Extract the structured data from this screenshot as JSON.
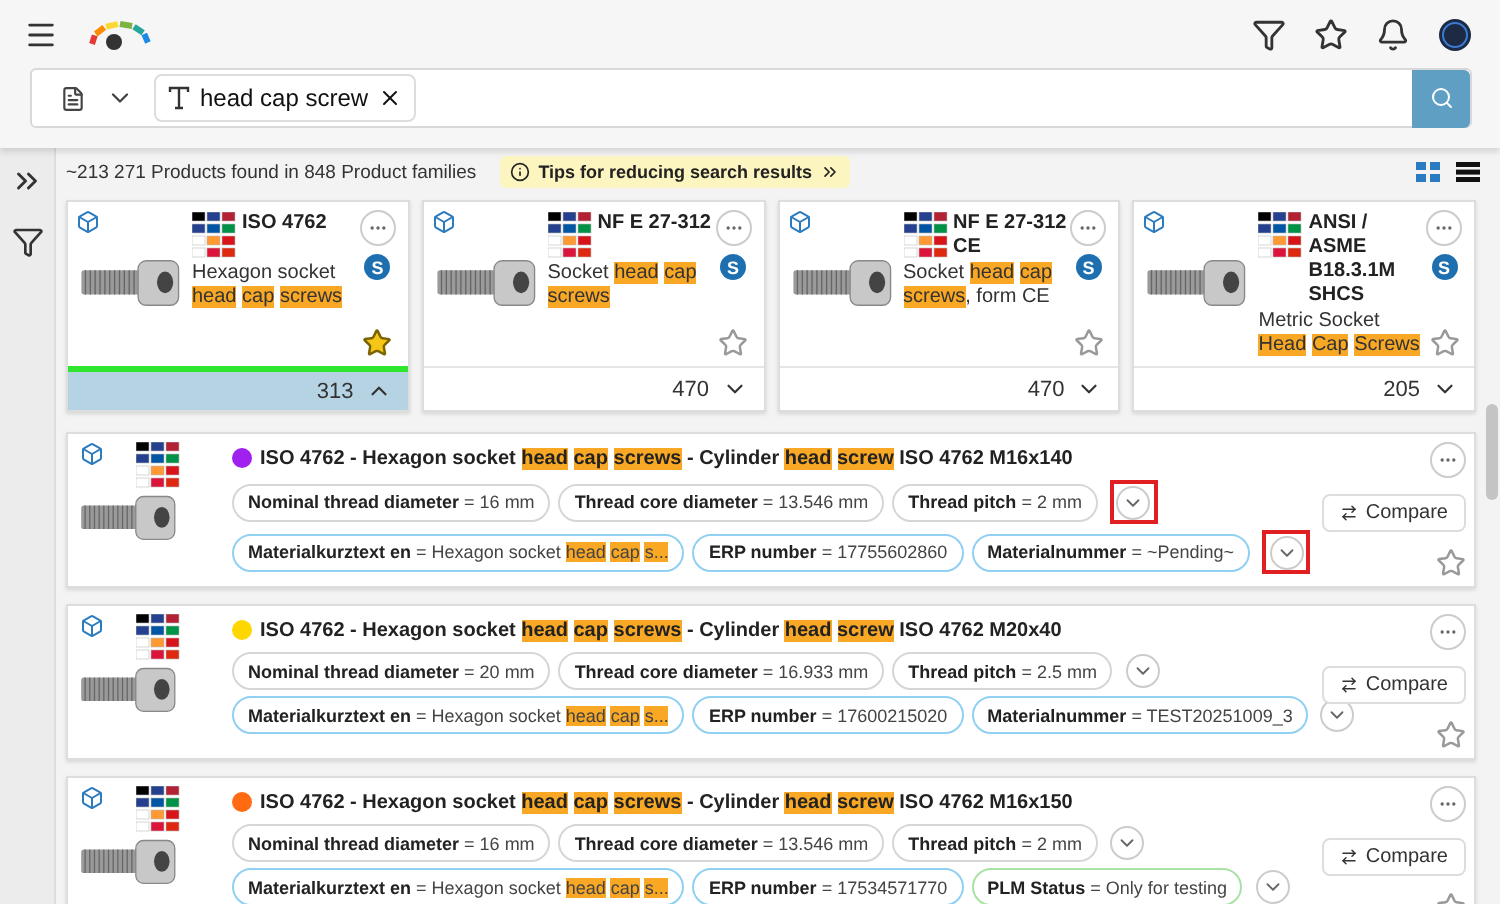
{
  "search": {
    "chip": "head cap screw"
  },
  "summary": {
    "text": "~213 271 Products found in 848 Product families",
    "tips": "Tips for reducing search results"
  },
  "cards": [
    {
      "title": "ISO 4762",
      "desc": [
        {
          "t": "Hexagon socket "
        },
        {
          "t": "head cap screws",
          "hl": true
        }
      ],
      "badge": "S",
      "count": "313",
      "selected": true,
      "favorite": true,
      "expanded": true
    },
    {
      "title": "NF E 27-312",
      "desc": [
        {
          "t": "Socket "
        },
        {
          "t": "head cap screws",
          "hl": true
        }
      ],
      "badge": "S",
      "count": "470",
      "selected": false,
      "favorite": false,
      "expanded": false
    },
    {
      "title": "NF E 27-312 CE",
      "desc": [
        {
          "t": "Socket "
        },
        {
          "t": "head cap screws",
          "hl": true
        },
        {
          "t": ", form CE"
        }
      ],
      "badge": "S",
      "count": "470",
      "selected": false,
      "favorite": false,
      "expanded": false
    },
    {
      "title": "ANSI / ASME B18.3.1M SHCS",
      "desc": [
        {
          "t": "Metric Socket "
        },
        {
          "t": "Head Cap Screws",
          "hl": true
        }
      ],
      "badge": "S",
      "count": "205",
      "selected": false,
      "favorite": false,
      "expanded": false
    }
  ],
  "results": [
    {
      "color": "#a020f0",
      "title": [
        {
          "t": "ISO 4762 - Hexagon socket "
        },
        {
          "t": "head cap screws",
          "hl": true
        },
        {
          "t": " - Cylinder "
        },
        {
          "t": "head screw",
          "hl": true
        },
        {
          "t": " ISO 4762 M16x140"
        }
      ],
      "lines": [
        {
          "outlined": true,
          "props": [
            {
              "kind": "plain",
              "name": "Nominal thread diameter",
              "value": [
                {
                  "t": "= 16 mm"
                }
              ]
            },
            {
              "kind": "plain",
              "name": "Thread core diameter",
              "value": [
                {
                  "t": "= 13.546 mm"
                }
              ]
            },
            {
              "kind": "plain",
              "name": "Thread pitch",
              "value": [
                {
                  "t": "= 2 mm"
                }
              ]
            }
          ]
        },
        {
          "outlined": true,
          "props": [
            {
              "kind": "erp",
              "name": "Materialkurztext en",
              "value": [
                {
                  "t": "= Hexagon socket "
                },
                {
                  "t": "head cap s...",
                  "hl": true
                }
              ]
            },
            {
              "kind": "erp",
              "name": "ERP number",
              "value": [
                {
                  "t": "= 17755602860"
                }
              ]
            },
            {
              "kind": "erp",
              "name": "Materialnummer",
              "value": [
                {
                  "t": "= ~Pending~"
                }
              ]
            }
          ]
        }
      ],
      "compare": "Compare"
    },
    {
      "color": "#ffd700",
      "title": [
        {
          "t": "ISO 4762 - Hexagon socket "
        },
        {
          "t": "head cap screws",
          "hl": true
        },
        {
          "t": " - Cylinder "
        },
        {
          "t": "head screw",
          "hl": true
        },
        {
          "t": " ISO 4762 M20x40"
        }
      ],
      "lines": [
        {
          "outlined": false,
          "props": [
            {
              "kind": "plain",
              "name": "Nominal thread diameter",
              "value": [
                {
                  "t": "= 20 mm"
                }
              ]
            },
            {
              "kind": "plain",
              "name": "Thread core diameter",
              "value": [
                {
                  "t": "= 16.933 mm"
                }
              ]
            },
            {
              "kind": "plain",
              "name": "Thread pitch",
              "value": [
                {
                  "t": "= 2.5 mm"
                }
              ]
            }
          ]
        },
        {
          "outlined": false,
          "props": [
            {
              "kind": "erp",
              "name": "Materialkurztext en",
              "value": [
                {
                  "t": "= Hexagon socket "
                },
                {
                  "t": "head cap s...",
                  "hl": true
                }
              ]
            },
            {
              "kind": "erp",
              "name": "ERP number",
              "value": [
                {
                  "t": "= 17600215020"
                }
              ]
            },
            {
              "kind": "erp",
              "name": "Materialnummer",
              "value": [
                {
                  "t": "= TEST20251009_3"
                }
              ]
            }
          ]
        }
      ],
      "compare": "Compare"
    },
    {
      "color": "#ff6a13",
      "title": [
        {
          "t": "ISO 4762 - Hexagon socket "
        },
        {
          "t": "head cap screws",
          "hl": true
        },
        {
          "t": " - Cylinder "
        },
        {
          "t": "head screw",
          "hl": true
        },
        {
          "t": " ISO 4762 M16x150"
        }
      ],
      "lines": [
        {
          "outlined": false,
          "props": [
            {
              "kind": "plain",
              "name": "Nominal thread diameter",
              "value": [
                {
                  "t": "= 16 mm"
                }
              ]
            },
            {
              "kind": "plain",
              "name": "Thread core diameter",
              "value": [
                {
                  "t": "= 13.546 mm"
                }
              ]
            },
            {
              "kind": "plain",
              "name": "Thread pitch",
              "value": [
                {
                  "t": "= 2 mm"
                }
              ]
            }
          ]
        },
        {
          "outlined": false,
          "props": [
            {
              "kind": "erp",
              "name": "Materialkurztext en",
              "value": [
                {
                  "t": "= Hexagon socket "
                },
                {
                  "t": "head cap s...",
                  "hl": true
                }
              ]
            },
            {
              "kind": "erp",
              "name": "ERP number",
              "value": [
                {
                  "t": "= 17534571770"
                }
              ]
            },
            {
              "kind": "status",
              "name": "PLM Status",
              "value": [
                {
                  "t": "= Only for testing"
                }
              ]
            }
          ]
        }
      ],
      "compare": "Compare"
    }
  ]
}
